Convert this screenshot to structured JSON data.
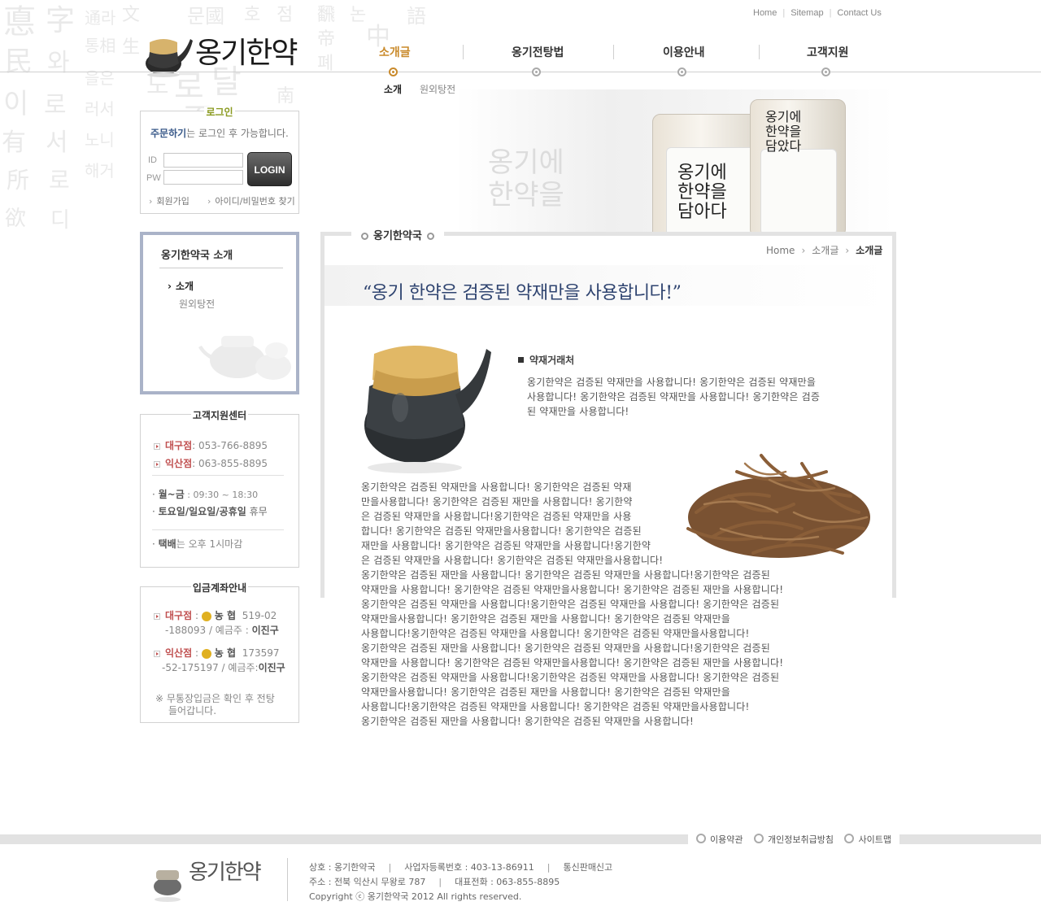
{
  "utility": [
    "Home",
    "Sitemap",
    "Contact Us"
  ],
  "logo_text": "옹기한약",
  "gnb": [
    {
      "label": "소개글",
      "active": true
    },
    {
      "label": "옹기전탕법",
      "active": false
    },
    {
      "label": "이용안내",
      "active": false
    },
    {
      "label": "고객지원",
      "active": false
    }
  ],
  "sub_gnb": [
    {
      "label": "소개",
      "active": true
    },
    {
      "label": "원외탕전",
      "active": false
    }
  ],
  "login": {
    "title": "로그인",
    "note_bold": "주문하기",
    "note_rest": "는 로그인 후 가능합니다.",
    "id_label": "ID",
    "pw_label": "PW",
    "button": "LOGIN",
    "join": "회원가입",
    "find": "아이디/비밀번호 찾기"
  },
  "lnb": {
    "title": "옹기한약국 소개",
    "items": [
      "소개",
      "원외탕전"
    ]
  },
  "customer": {
    "title": "고객지원센터",
    "branches": [
      {
        "name": "대구점",
        "phone": ": 053-766-8895"
      },
      {
        "name": "익산점",
        "phone": ": 063-855-8895"
      }
    ],
    "hours": [
      {
        "bold": "월~금",
        "rest": " : 09:30 ~ 18:30"
      },
      {
        "bold": "토요일/일요일/공휴일",
        "rest": " 휴무"
      }
    ],
    "delivery_bold": "택배",
    "delivery_rest": "는 오후 1시마감"
  },
  "account": {
    "title": "입금계좌안내",
    "items": [
      {
        "branch": "대구점",
        "bank": "농 협",
        "line1": "519-02",
        "line2": "-188093 / 예금주 :",
        "owner": "이진구"
      },
      {
        "branch": "익산점",
        "bank": "농 협",
        "line1": "173597",
        "line2": "-52-175197 / 예금주:",
        "owner": "이진구"
      }
    ],
    "note1": "※ 무통장입금은 확인 후 전탕",
    "note2": "들어갑니다."
  },
  "content": {
    "title": "옹기한약국",
    "breadcrumb": [
      "Home",
      "소개글",
      "소개글"
    ],
    "quote": "“옹기 한약은 검증된 약재만을 사용합니다!”",
    "section_head": "약재거래처",
    "para1": [
      "옹기한약은 검증된 약재만을 사용합니다! 옹기한약은 검증된 약재만을",
      "사용합니다! 옹기한약은 검증된 약재만을 사용합니다! 옹기한약은 검증",
      "된 약재만을 사용합니다!"
    ],
    "para2": [
      "옹기한약은 검증된 약재만을 사용합니다! 옹기한약은 검증된 약재",
      "만을사용합니다! 옹기한약은 검증된 재만을 사용합니다! 옹기한약",
      "은 검증된 약재만을 사용합니다!옹기한약은 검증된 약재만을 사용",
      "합니다! 옹기한약은 검증된 약재만을사용합니다! 옹기한약은 검증된",
      " 재만을 사용합니다! 옹기한약은 검증된 약재만을 사용합니다!옹기한약",
      "은 검증된 약재만을 사용합니다! 옹기한약은 검증된 약재만을사용합니다!",
      "옹기한약은 검증된 재만을 사용합니다! 옹기한약은 검증된 약재만을 사용합니다!옹기한약은 검증된",
      "약재만을 사용합니다! 옹기한약은 검증된 약재만을사용합니다! 옹기한약은 검증된 재만을 사용합니다!",
      "옹기한약은 검증된 약재만을 사용합니다!옹기한약은 검증된 약재만을 사용합니다! 옹기한약은 검증된",
      "약재만을사용합니다! 옹기한약은 검증된 재만을 사용합니다! 옹기한약은 검증된 약재만을",
      "사용합니다!옹기한약은 검증된 약재만을 사용합니다! 옹기한약은 검증된 약재만을사용합니다!",
      "옹기한약은 검증된 재만을 사용합니다! 옹기한약은 검증된 약재만을 사용합니다!옹기한약은 검증된",
      "약재만을 사용합니다! 옹기한약은 검증된 약재만을사용합니다! 옹기한약은 검증된 재만을 사용합니다!",
      "옹기한약은 검증된 약재만을 사용합니다!옹기한약은 검증된 약재만을 사용합니다! 옹기한약은 검증된",
      "약재만을사용합니다! 옹기한약은 검증된 재만을 사용합니다! 옹기한약은 검증된 약재만을",
      "사용합니다!옹기한약은 검증된 약재만을 사용합니다! 옹기한약은 검증된 약재만을사용합니다!",
      "옹기한약은 검증된 재만을 사용합니다! 옹기한약은 검증된 약재만을 사용합니다!"
    ]
  },
  "footer": {
    "links": [
      "이용약관",
      "개인정보취급방침",
      "사이트맵"
    ],
    "logo_text": "옹기한약",
    "info1": [
      "상호 : 옹기한약국",
      "사업자등록번호 : 403-13-86911",
      "통신판매신고"
    ],
    "info2": [
      "주소 : 전북 익산시 무왕로 787",
      "대표전화 : 063-855-8895"
    ],
    "copyright": "Copyright ⓒ 옹기한약국 2012 All rights reserved."
  }
}
